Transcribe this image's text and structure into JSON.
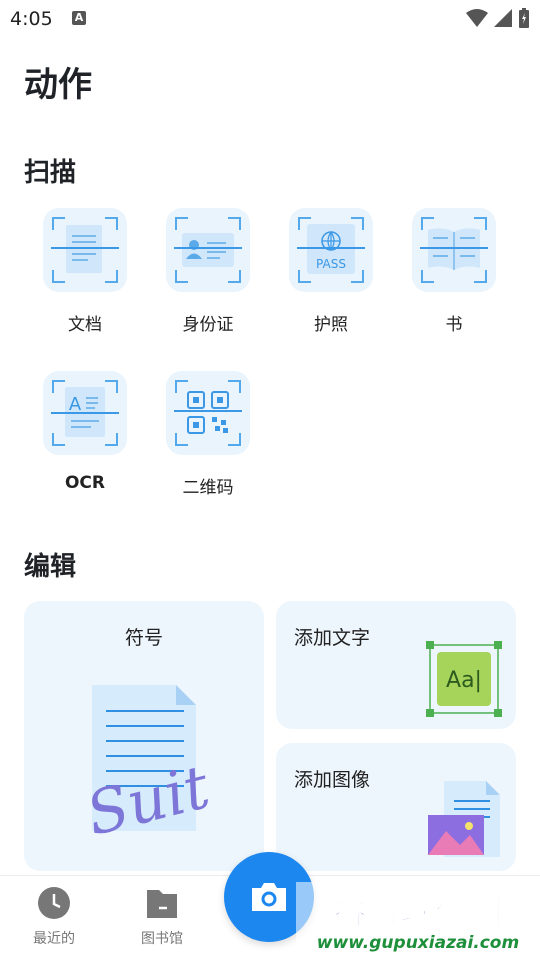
{
  "status_bar": {
    "time": "4:05",
    "badge": "A"
  },
  "page_title": "动作",
  "scan_section": {
    "title": "扫描",
    "items": [
      {
        "label": "文档",
        "icon": "document-scan-icon"
      },
      {
        "label": "身份证",
        "icon": "id-card-scan-icon"
      },
      {
        "label": "护照",
        "icon": "passport-scan-icon"
      },
      {
        "label": "书",
        "icon": "book-scan-icon"
      },
      {
        "label": "OCR",
        "icon": "ocr-scan-icon"
      },
      {
        "label": "二维码",
        "icon": "qr-code-scan-icon"
      }
    ],
    "passport_text": "PASS",
    "ocr_glyph": "A"
  },
  "edit_section": {
    "title": "编辑",
    "signature_label": "符号",
    "signature_text": "Suit",
    "add_text_label": "添加文字",
    "add_text_sample": "Aa|",
    "add_image_label": "添加图像"
  },
  "bottom_nav": {
    "items": [
      {
        "label": "最近的",
        "icon": "clock-icon"
      },
      {
        "label": "图书馆",
        "icon": "folder-icon"
      }
    ],
    "camera_icon": "camera-icon"
  },
  "watermark": {
    "title": "谷普软件园",
    "url": "www.gupuxiazai.com"
  },
  "colors": {
    "accent": "#1d87f0",
    "tile_bg": "#e9f4fd",
    "card_bg": "#eef6fd",
    "green": "#4caf50"
  }
}
